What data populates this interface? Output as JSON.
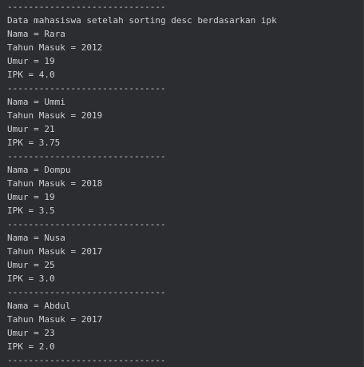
{
  "console": {
    "separator": "------------------------------",
    "header": "Data mahasiswa setelah sorting desc berdasarkan ipk",
    "records": [
      {
        "nama": "Nama = Rara",
        "tahun": "Tahun Masuk = 2012",
        "umur": "Umur = 19",
        "ipk": "IPK = 4.0"
      },
      {
        "nama": "Nama = Ummi",
        "tahun": "Tahun Masuk = 2019",
        "umur": "Umur = 21",
        "ipk": "IPK = 3.75"
      },
      {
        "nama": "Nama = Dompu",
        "tahun": "Tahun Masuk = 2018",
        "umur": "Umur = 19",
        "ipk": "IPK = 3.5"
      },
      {
        "nama": "Nama = Nusa",
        "tahun": "Tahun Masuk = 2017",
        "umur": "Umur = 25",
        "ipk": "IPK = 3.0"
      },
      {
        "nama": "Nama = Abdul",
        "tahun": "Tahun Masuk = 2017",
        "umur": "Umur = 23",
        "ipk": "IPK = 2.0"
      }
    ]
  }
}
